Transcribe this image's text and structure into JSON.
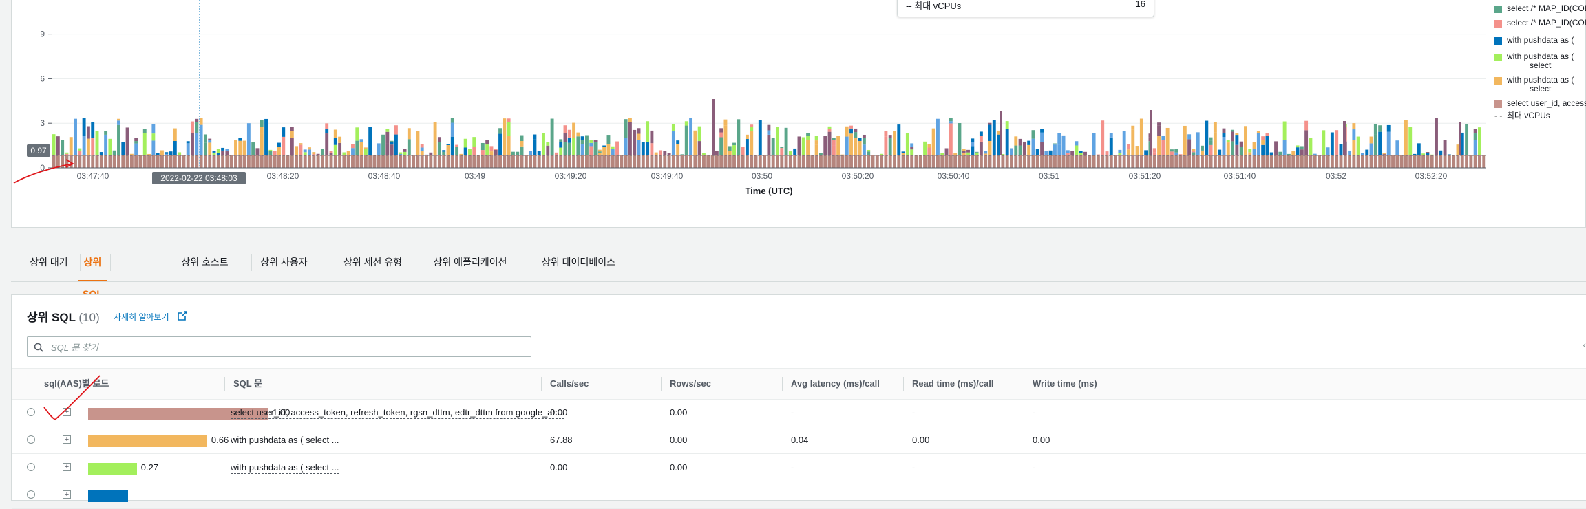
{
  "chart": {
    "y_ticks": [
      "0",
      "3",
      "6",
      "9"
    ],
    "x_ticks": [
      "03:47:40",
      "03:48:20",
      "03:48:40",
      "03:49",
      "03:49:20",
      "03:49:40",
      "03:50",
      "03:50:20",
      "03:50:40",
      "03:51",
      "03:51:20",
      "03:51:40",
      "03:52",
      "03:52:20"
    ],
    "x_axis_title": "Time (UTC)",
    "hover_timestamp": "2022-02-22 03:48:03",
    "y_hover_value": "0.97",
    "tooltip": {
      "label": "-- 최대 vCPUs",
      "value": "16"
    },
    "legend": [
      {
        "label": "select /* MAP_ID(COLA",
        "color": "#5aa68a"
      },
      {
        "label": "select /* MAP_ID(COLA",
        "color": "#f4918b"
      },
      {
        "label": "with pushdata as (",
        "color": "#0073bb"
      },
      {
        "label": "with pushdata as (\nselect",
        "color": "#a3ef5c"
      },
      {
        "label": "with pushdata as (\nselect",
        "color": "#f2b75e"
      },
      {
        "label": "select user_id, access_t",
        "color": "#c8948c"
      }
    ],
    "legend_max_vcpu": "최대 vCPUs",
    "colors": {
      "baseline": "#b5857d",
      "dark": "#8a5d7a",
      "light_blue": "#5fa3e2"
    }
  },
  "tabs": [
    {
      "label": "상위 대기",
      "active": false
    },
    {
      "label": "상위 SQL",
      "active": true
    },
    {
      "label": "상위 호스트",
      "active": false
    },
    {
      "label": "상위 사용자",
      "active": false
    },
    {
      "label": "상위 세션 유형",
      "active": false
    },
    {
      "label": "상위 애플리케이션",
      "active": false
    },
    {
      "label": "상위 데이터베이스",
      "active": false
    }
  ],
  "sql_panel": {
    "title": "상위 SQL",
    "count": "(10)",
    "learn_more": "자세히 알아보기",
    "search_placeholder": "SQL 문 찾기",
    "columns": [
      "sql(AAS)별 로드",
      "SQL 문",
      "Calls/sec",
      "Rows/sec",
      "Avg latency (ms)/call",
      "Read time (ms)/call",
      "Write time (ms)"
    ],
    "rows": [
      {
        "load": 1.0,
        "load_label": "1.00",
        "bar_color": "#c8948c",
        "sql": "select user_id, access_token, refresh_token, rgsn_dttm, edtr_dttm from google_ac...",
        "calls": "0.00",
        "rows": "0.00",
        "latency": "-",
        "read": "-",
        "write": "-"
      },
      {
        "load": 0.66,
        "load_label": "0.66",
        "bar_color": "#f2b75e",
        "sql": "with pushdata as ( select ...",
        "calls": "67.88",
        "rows": "0.00",
        "latency": "0.04",
        "read": "0.00",
        "write": "0.00"
      },
      {
        "load": 0.27,
        "load_label": "0.27",
        "bar_color": "#a3ef5c",
        "sql": "with pushdata as ( select ...",
        "calls": "0.00",
        "rows": "0.00",
        "latency": "-",
        "read": "-",
        "write": "-"
      }
    ]
  }
}
